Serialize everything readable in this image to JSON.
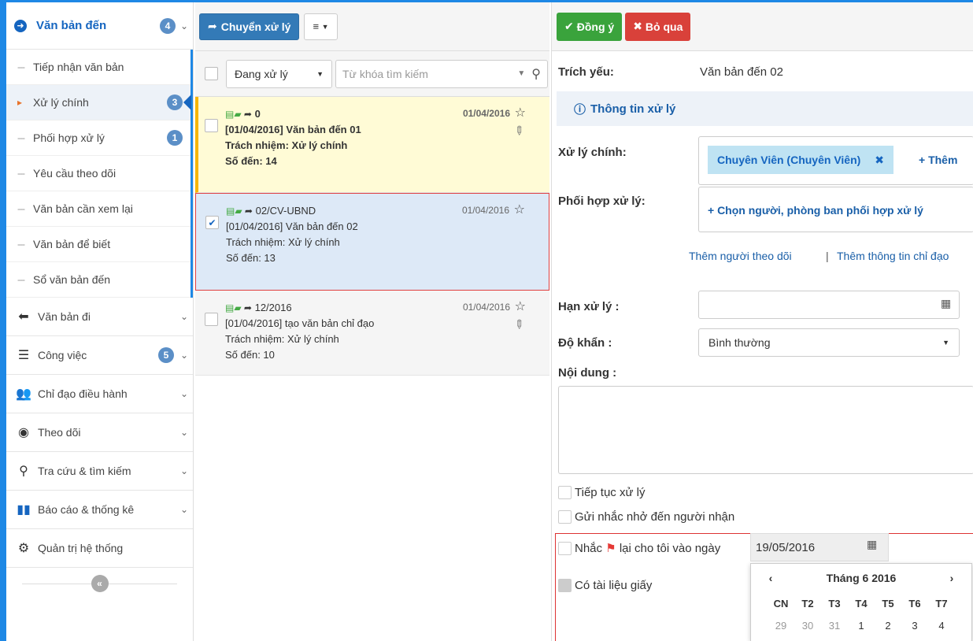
{
  "sidebar": {
    "header": {
      "label": "Văn bản đến",
      "badge": "4"
    },
    "subitems": [
      {
        "label": "Tiếp nhận văn bản",
        "badge": ""
      },
      {
        "label": "Xử lý chính",
        "badge": "3"
      },
      {
        "label": "Phối hợp xử lý",
        "badge": "1"
      },
      {
        "label": "Yêu cầu theo dõi",
        "badge": ""
      },
      {
        "label": "Văn bản cần xem lại",
        "badge": ""
      },
      {
        "label": "Văn bản để biết",
        "badge": ""
      },
      {
        "label": "Sổ văn bản đến",
        "badge": ""
      }
    ],
    "menus": [
      {
        "label": "Văn bản đi",
        "icon": "arrow-left-circle-icon",
        "badge": ""
      },
      {
        "label": "Công việc",
        "icon": "tasks-icon",
        "badge": "5"
      },
      {
        "label": "Chỉ đạo điều hành",
        "icon": "users-icon",
        "badge": ""
      },
      {
        "label": "Theo dõi",
        "icon": "eye-icon",
        "badge": ""
      },
      {
        "label": "Tra cứu & tìm kiếm",
        "icon": "search-icon",
        "badge": ""
      },
      {
        "label": "Báo cáo & thống kê",
        "icon": "bar-chart-icon",
        "badge": ""
      },
      {
        "label": "Quản trị hệ thống",
        "icon": "gears-icon",
        "badge": ""
      }
    ]
  },
  "list": {
    "toolbar": {
      "forward_label": "Chuyển xử lý"
    },
    "filter": {
      "status": "Đang xử lý",
      "search_placeholder": "Từ khóa tìm kiếm"
    },
    "items": [
      {
        "number": "0",
        "date": "01/04/2016",
        "title": "[01/04/2016] Văn bản đến 01",
        "role": "Trách nhiệm: Xử lý chính",
        "count": "Số đến: 14"
      },
      {
        "number": "02/CV-UBND",
        "date": "01/04/2016",
        "title": "[01/04/2016] Văn bản đến 02",
        "role": "Trách nhiệm: Xử lý chính",
        "count": "Số đến: 13"
      },
      {
        "number": "12/2016",
        "date": "01/04/2016",
        "title": "[01/04/2016] tạo văn bản chỉ đạo",
        "role": "Trách nhiệm: Xử lý chính",
        "count": "Số đến: 10"
      }
    ]
  },
  "detail": {
    "toolbar": {
      "accept_label": "Đồng ý",
      "skip_label": "Bỏ qua"
    },
    "summary_label": "Trích yếu:",
    "summary_value": "Văn bản đến 02",
    "info_title": "Thông tin xử lý",
    "main_label": "Xử lý chính:",
    "main_chip": "Chuyên Viên (Chuyên Viên)",
    "add_label": "+ Thêm",
    "coop_label": "Phối hợp xử lý:",
    "coop_link": "+ Chọn người, phòng ban phối hợp xử lý",
    "link_follow": "Thêm người theo dõi",
    "link_sep": "|",
    "link_direct": "Thêm thông tin chỉ đạo",
    "deadline_label": "Hạn xử lý :",
    "urgency_label": "Độ khẩn :",
    "urgency_value": "Bình thường",
    "content_label": "Nội dung :",
    "continue_label": "Tiếp tục xử lý",
    "notify_label": "Gửi nhắc nhở đến người nhận",
    "remind_pre": "Nhắc",
    "remind_post": "lại cho tôi vào ngày",
    "remind_date": "19/05/2016",
    "paper_label": "Có tài liệu giấy",
    "calendar": {
      "prev": "‹",
      "month": "Tháng 6 2016",
      "next": "›",
      "weekdays": [
        "CN",
        "T2",
        "T3",
        "T4",
        "T5",
        "T6",
        "T7"
      ],
      "days": [
        "29",
        "30",
        "31",
        "1",
        "2",
        "3",
        "4"
      ]
    }
  }
}
